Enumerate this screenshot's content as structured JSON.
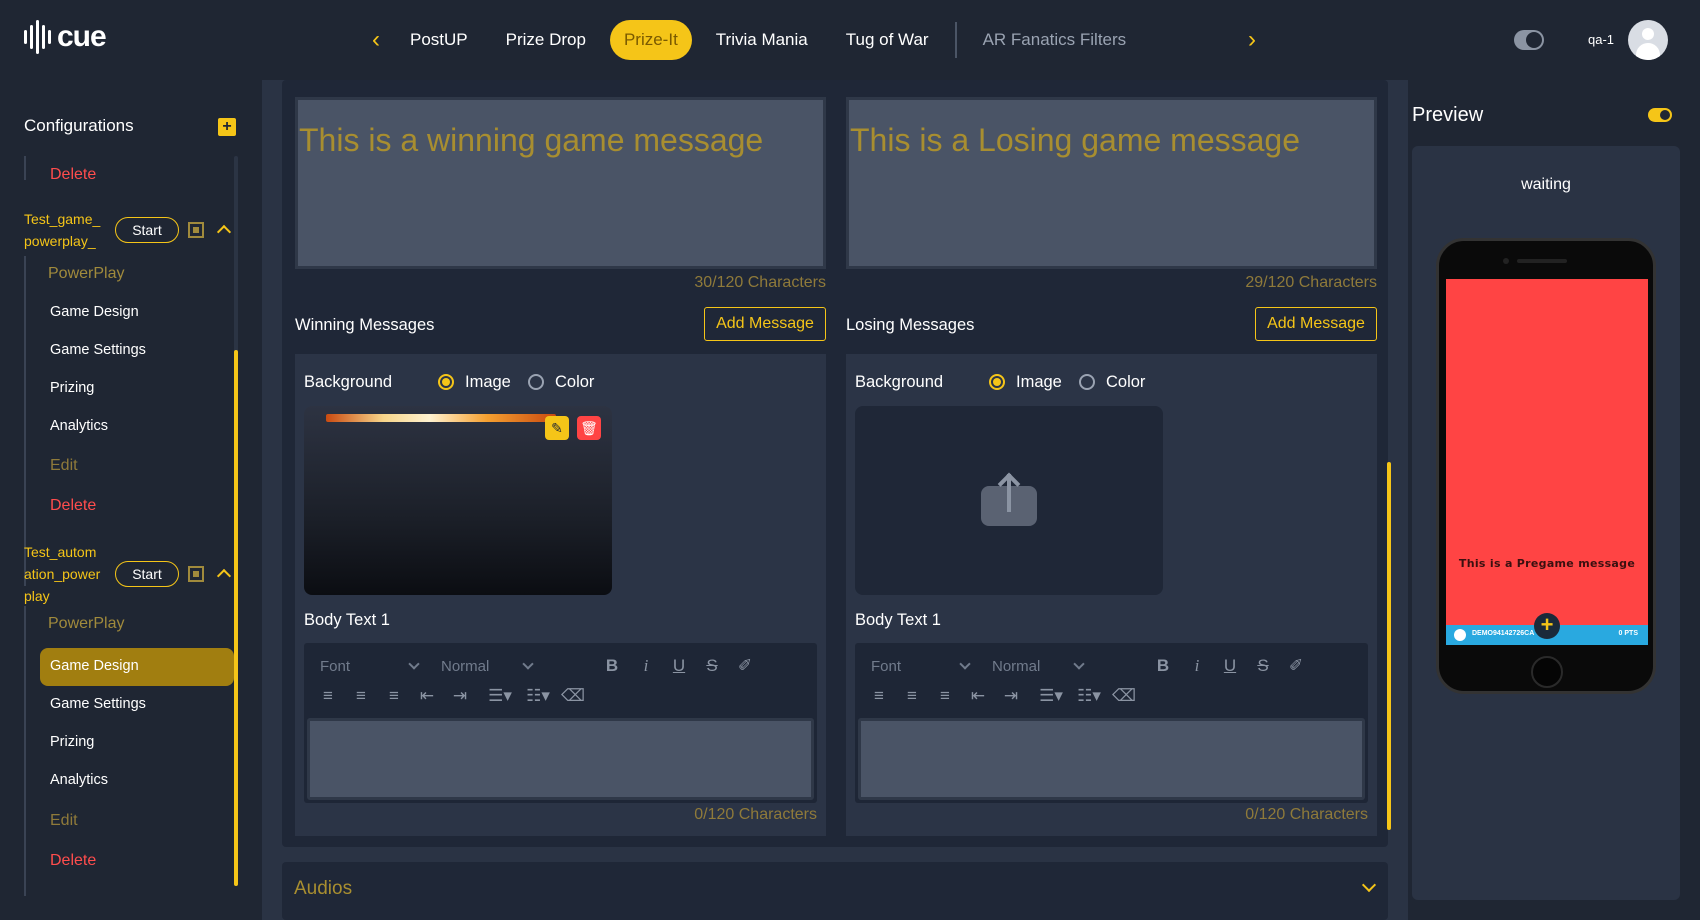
{
  "topbar": {
    "logo_text": "cue",
    "tabs": [
      {
        "label": "PostUP"
      },
      {
        "label": "Prize Drop"
      },
      {
        "label": "Prize-It"
      },
      {
        "label": "Trivia Mania"
      },
      {
        "label": "Tug of War"
      },
      {
        "label": "AR Fanatics Filters"
      }
    ],
    "active_tab": "Prize-It",
    "user_name": "qa-1",
    "accent_color": "#f5c518"
  },
  "sidebar": {
    "title": "Configurations",
    "add_icon": "+",
    "top_delete": "Delete",
    "games": [
      {
        "name_line1": "Test_game_",
        "name_line2": "powerplay_",
        "name_line3": "",
        "start_label": "Start",
        "category": "PowerPlay",
        "items": [
          "Game Design",
          "Game Settings",
          "Prizing",
          "Analytics"
        ],
        "edit_label": "Edit",
        "delete_label": "Delete"
      },
      {
        "name_line1": "Test_autom",
        "name_line2": "ation_power",
        "name_line3": "play",
        "start_label": "Start",
        "category": "PowerPlay",
        "items": [
          "Game Design",
          "Game Settings",
          "Prizing",
          "Analytics"
        ],
        "edit_label": "Edit",
        "delete_label": "Delete",
        "active_item": "Game Design"
      }
    ]
  },
  "main": {
    "winning": {
      "message_text": "This is a winning game message",
      "message_count": "30/120 Characters",
      "section_label": "Winning Messages",
      "add_label": "Add Message",
      "background_label": "Background",
      "option_image": "Image",
      "option_color": "Color",
      "selected_option": "Image",
      "body_label": "Body Text 1",
      "font_placeholder": "Font",
      "size_placeholder": "Normal",
      "body_count": "0/120 Characters"
    },
    "losing": {
      "message_text": "This is a Losing game message",
      "message_count": "29/120 Characters",
      "section_label": "Losing Messages",
      "add_label": "Add Message",
      "background_label": "Background",
      "option_image": "Image",
      "option_color": "Color",
      "selected_option": "Image",
      "body_label": "Body Text 1",
      "font_placeholder": "Font",
      "size_placeholder": "Normal",
      "body_count": "0/120 Characters"
    },
    "audios_label": "Audios"
  },
  "preview": {
    "title": "Preview",
    "status": "waiting",
    "phone_message": "This is a Pregame message",
    "player_id": "DEMO94142726CA",
    "points": "0 PTS",
    "screen_color": "#ff4444",
    "bar_color": "#29a9e0"
  }
}
